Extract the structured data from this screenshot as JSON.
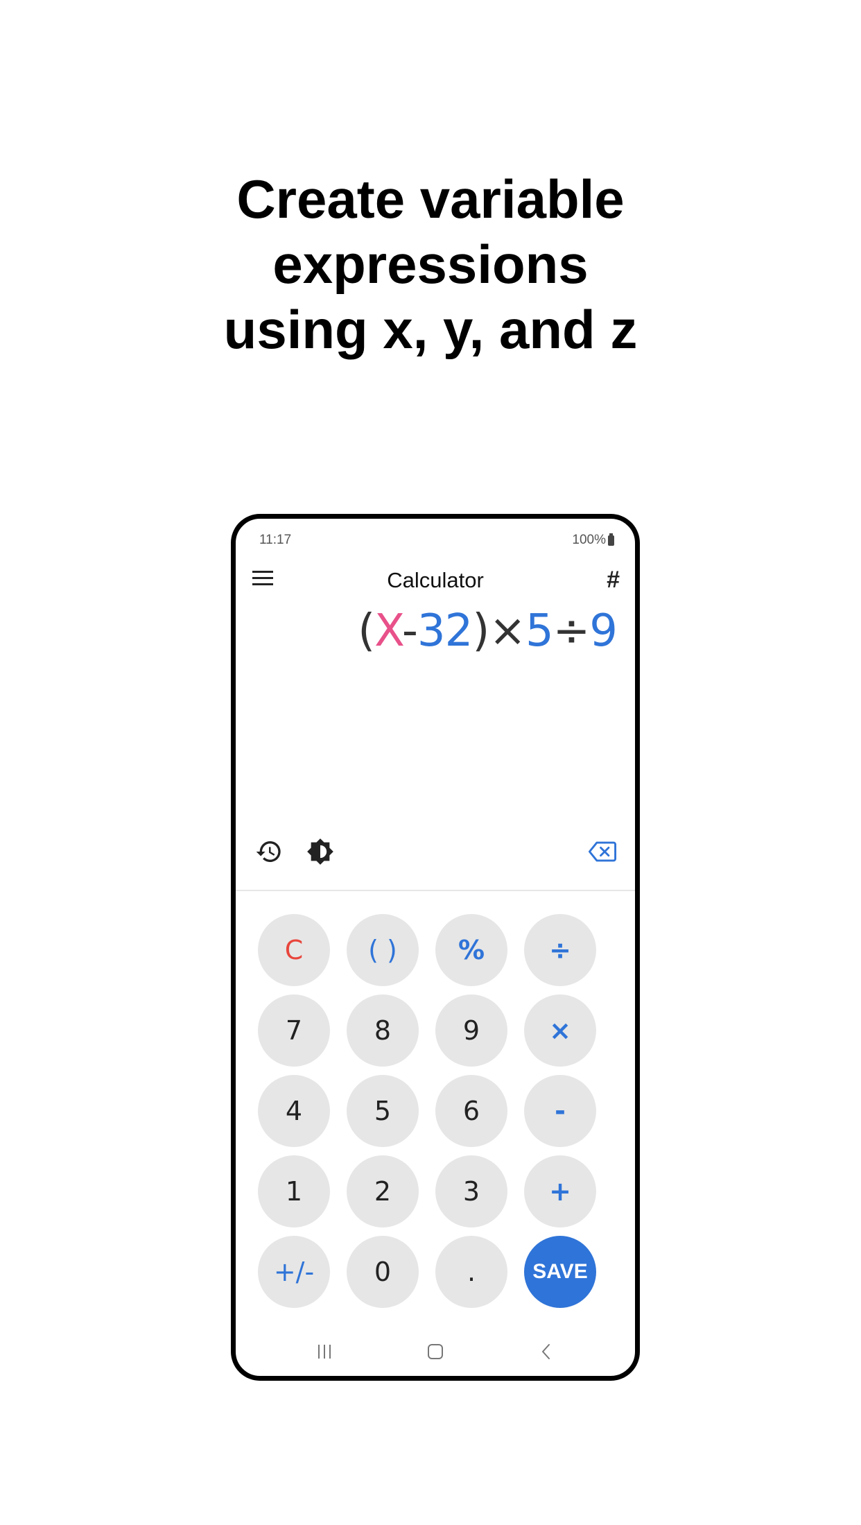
{
  "headline": {
    "line1": "Create variable",
    "line2": "expressions",
    "line3": "using x, y, and z"
  },
  "status_bar": {
    "time": "11:17",
    "battery": "100%"
  },
  "app_bar": {
    "title": "Calculator",
    "menu_icon": "hamburger-menu-icon",
    "right_icon": "hash-icon"
  },
  "expression": {
    "tokens": [
      {
        "text": "(",
        "color": "#333333"
      },
      {
        "text": "X",
        "color": "#e8518a"
      },
      {
        "text": "-",
        "color": "#333333"
      },
      {
        "text": "32",
        "color": "#2f74d8"
      },
      {
        "text": ")",
        "color": "#333333"
      },
      {
        "text": "×",
        "color": "#333333"
      },
      {
        "text": "5",
        "color": "#2f74d8"
      },
      {
        "text": "÷",
        "color": "#333333"
      },
      {
        "text": "9",
        "color": "#2f74d8"
      }
    ]
  },
  "tools": {
    "history_icon": "history-icon",
    "theme_icon": "brightness-icon",
    "backspace_icon": "backspace-icon"
  },
  "keypad": {
    "rows": [
      [
        {
          "label": "C",
          "kind": "clear"
        },
        {
          "label": "( )",
          "kind": "paren"
        },
        {
          "label": "%",
          "kind": "op"
        },
        {
          "label": "÷",
          "kind": "op"
        }
      ],
      [
        {
          "label": "7",
          "kind": "num"
        },
        {
          "label": "8",
          "kind": "num"
        },
        {
          "label": "9",
          "kind": "num"
        },
        {
          "label": "×",
          "kind": "op"
        }
      ],
      [
        {
          "label": "4",
          "kind": "num"
        },
        {
          "label": "5",
          "kind": "num"
        },
        {
          "label": "6",
          "kind": "num"
        },
        {
          "label": "-",
          "kind": "op"
        }
      ],
      [
        {
          "label": "1",
          "kind": "num"
        },
        {
          "label": "2",
          "kind": "num"
        },
        {
          "label": "3",
          "kind": "num"
        },
        {
          "label": "+",
          "kind": "op"
        }
      ],
      [
        {
          "label": "+/-",
          "kind": "paren"
        },
        {
          "label": "0",
          "kind": "num"
        },
        {
          "label": ".",
          "kind": "num"
        },
        {
          "label": "SAVE",
          "kind": "save"
        }
      ]
    ]
  },
  "nav_bar": {
    "recents_icon": "recents-icon",
    "home_icon": "home-icon",
    "back_icon": "back-icon"
  },
  "colors": {
    "accent": "#2f74d8",
    "variable": "#e8518a",
    "clear": "#e8453c",
    "key_bg": "#e6e6e6"
  }
}
